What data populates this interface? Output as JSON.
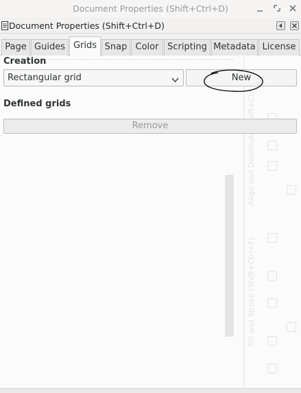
{
  "window": {
    "title": "Document Properties (Shift+Ctrl+D)",
    "controls": [
      "minimize-icon",
      "restore-icon",
      "close-icon"
    ]
  },
  "dock": {
    "title": "Document Properties (Shift+Ctrl+D)",
    "icons": [
      "document-icon",
      "dock-left-icon",
      "dock-close-icon"
    ]
  },
  "tabs": [
    {
      "label": "Page",
      "active": false
    },
    {
      "label": "Guides",
      "active": false
    },
    {
      "label": "Grids",
      "active": true
    },
    {
      "label": "Snap",
      "active": false
    },
    {
      "label": "Color",
      "active": false
    },
    {
      "label": "Scripting",
      "active": false
    },
    {
      "label": "Metadata",
      "active": false
    },
    {
      "label": "License",
      "active": false
    }
  ],
  "grids": {
    "creation_label": "Creation",
    "grid_type_selected": "Rectangular grid",
    "new_button": "New",
    "defined_grids_label": "Defined grids",
    "remove_button": "Remove"
  },
  "background_docks": {
    "align_label": "Align and Distribute (Shift+Ctrl+A)",
    "fill_label": "Fill and Stroke (Shift+Ctrl+F)"
  },
  "colors": {
    "panel_bg": "#fbfbfb",
    "window_bg": "#f2f1f0",
    "disabled_text": "#9a9a9a",
    "scribble": "#111111"
  }
}
